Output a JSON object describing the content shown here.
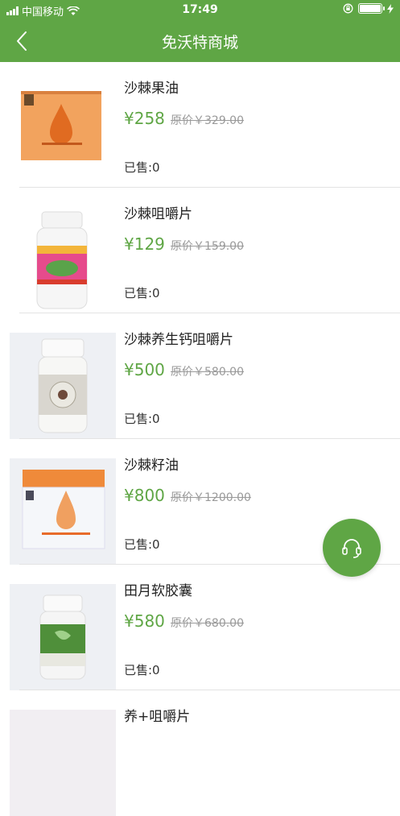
{
  "status_bar": {
    "carrier": "中国移动",
    "time": "17:49"
  },
  "nav": {
    "title": "免沃特商城"
  },
  "products": [
    {
      "name": "沙棘果油",
      "price": "¥258",
      "original_price": "原价￥329.00",
      "sold": "已售:0"
    },
    {
      "name": "沙棘咀嚼片",
      "price": "¥129",
      "original_price": "原价￥159.00",
      "sold": "已售:0"
    },
    {
      "name": "沙棘养生钙咀嚼片",
      "price": "¥500",
      "original_price": "原价￥580.00",
      "sold": "已售:0"
    },
    {
      "name": "沙棘籽油",
      "price": "¥800",
      "original_price": "原价￥1200.00",
      "sold": "已售:0"
    },
    {
      "name": "田月软胶囊",
      "price": "¥580",
      "original_price": "原价￥680.00",
      "sold": "已售:0"
    },
    {
      "name": "养+咀嚼片"
    }
  ],
  "colors": {
    "accent": "#5fa645",
    "original_price": "#9a9a9a"
  },
  "icons": {
    "back": "chevron-left-icon",
    "support": "headset-icon",
    "wifi": "wifi-icon",
    "battery": "battery-icon"
  }
}
